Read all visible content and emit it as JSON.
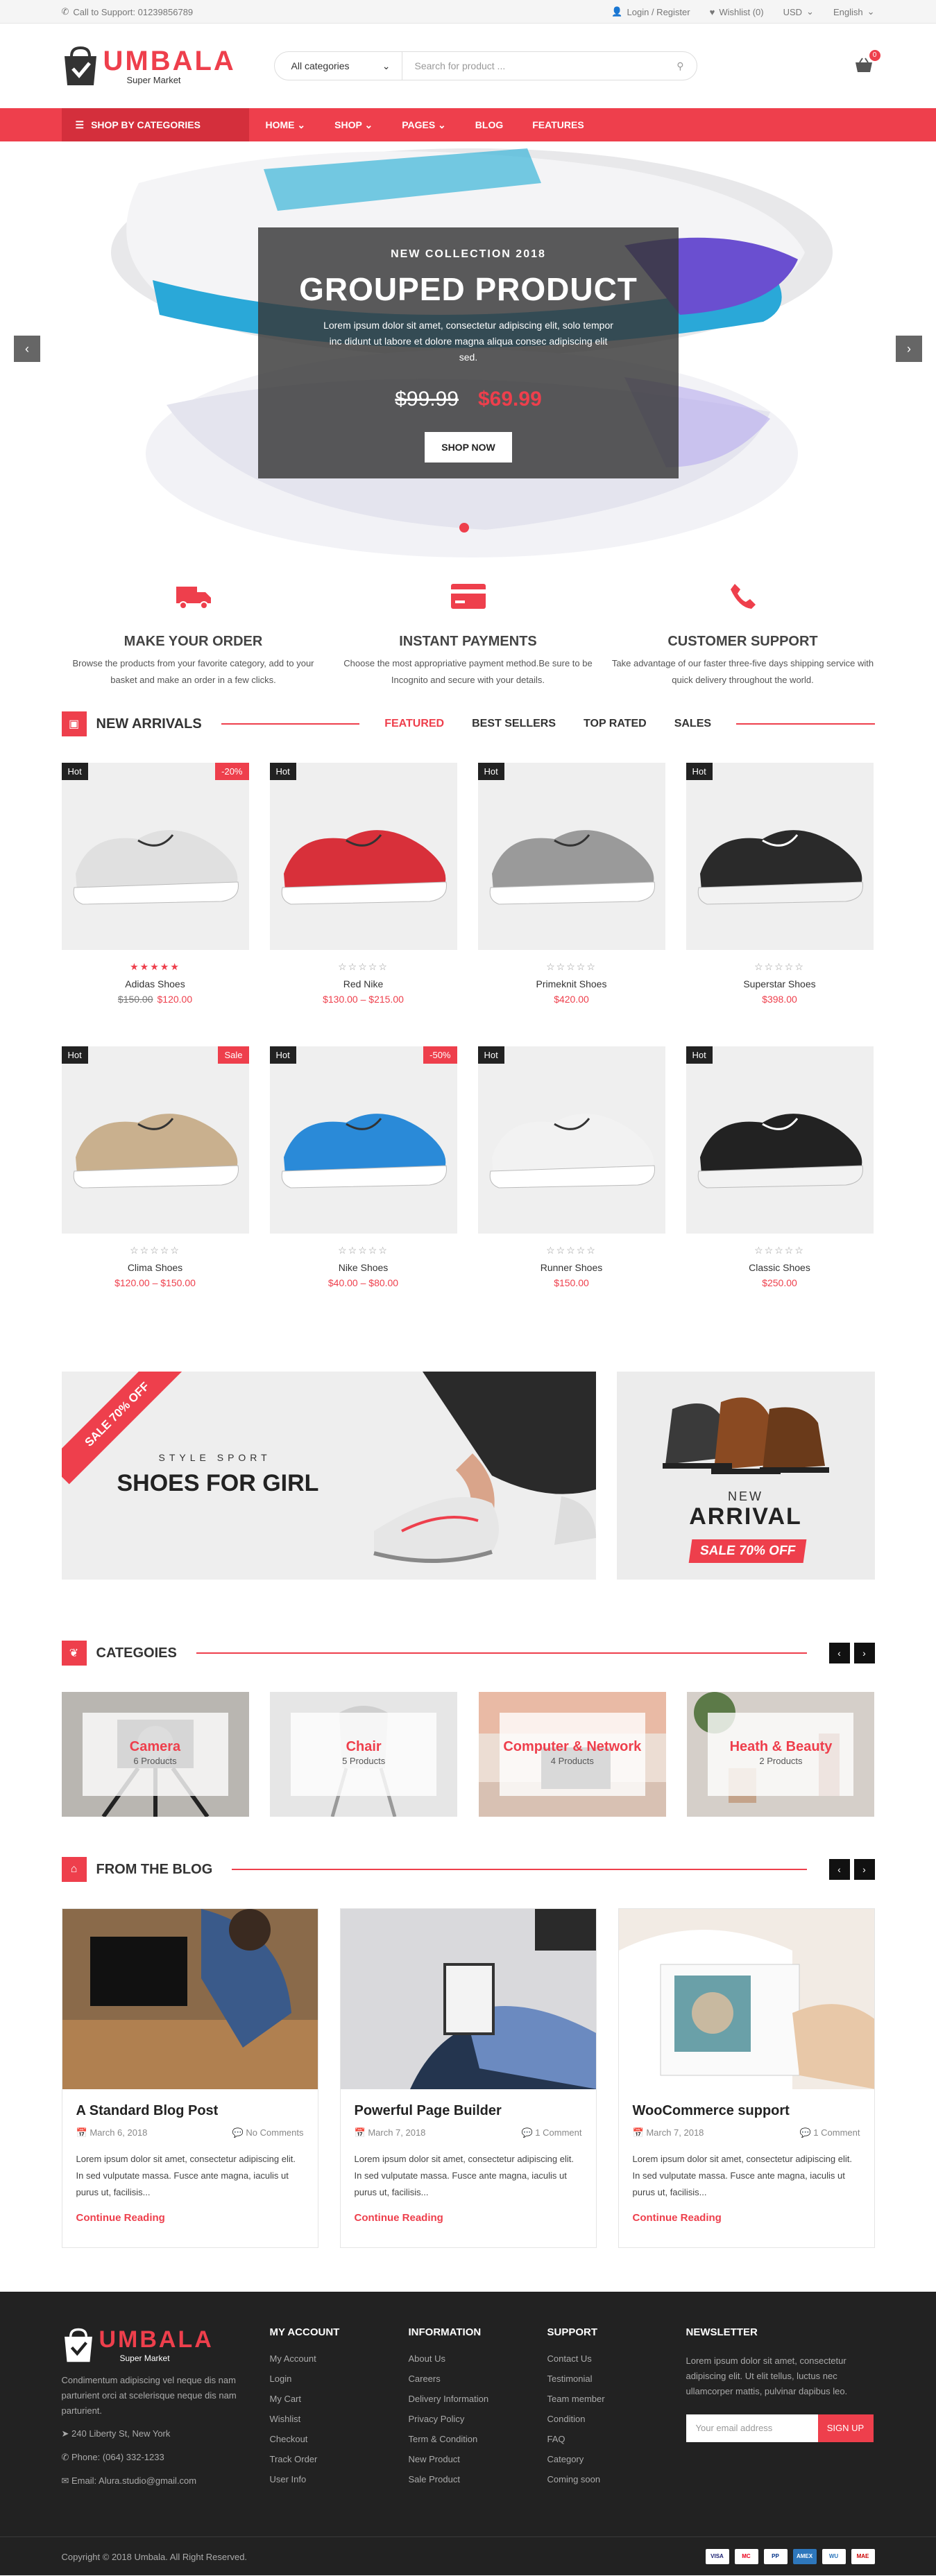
{
  "topbar": {
    "support": "Call to Support: 01239856789",
    "login": "Login / Register",
    "wishlist": "Wishlist (0)",
    "currency": "USD",
    "language": "English"
  },
  "logo": {
    "name": "UMBALA",
    "sub": "Super Market"
  },
  "search": {
    "category": "All categories",
    "placeholder": "Search for product ..."
  },
  "cart": {
    "count": "0"
  },
  "nav": {
    "categories": "SHOP BY CATEGORIES",
    "items": [
      "HOME",
      "SHOP",
      "PAGES",
      "BLOG",
      "FEATURES"
    ]
  },
  "hero": {
    "kicker": "NEW COLLECTION 2018",
    "title": "GROUPED PRODUCT",
    "text": "Lorem ipsum dolor sit amet, consectetur adipiscing elit, solo tempor inc didunt ut labore et dolore magna aliqua consec adipiscing elit sed.",
    "old_price": "$99.99",
    "new_price": "$69.99",
    "button": "SHOP NOW"
  },
  "features": [
    {
      "icon": "truck-icon",
      "title": "MAKE YOUR ORDER",
      "text": "Browse the products from your favorite category, add to your basket and make an order in a few clicks."
    },
    {
      "icon": "credit-card-icon",
      "title": "INSTANT PAYMENTS",
      "text": "Choose the most appropriative payment method.Be sure to be Incognito and secure with your details."
    },
    {
      "icon": "phone-icon",
      "title": "CUSTOMER SUPPORT",
      "text": "Take advantage of our faster three-five days shipping service with quick delivery throughout the world."
    }
  ],
  "arrivals": {
    "title": "NEW ARRIVALS",
    "tabs": [
      "FEATURED",
      "BEST SELLERS",
      "TOP RATED",
      "SALES"
    ],
    "products": [
      {
        "name": "Adidas Shoes",
        "old": "$150.00",
        "price": "$120.00",
        "hot": "Hot",
        "badge": "-20%",
        "rated": true,
        "color": "#e0e0e0"
      },
      {
        "name": "Red Nike",
        "old": "",
        "price": "$130.00 – $215.00",
        "hot": "Hot",
        "badge": "",
        "rated": false,
        "color": "#d8303a"
      },
      {
        "name": "Primeknit Shoes",
        "old": "",
        "price": "$420.00",
        "hot": "Hot",
        "badge": "",
        "rated": false,
        "color": "#9a9a9a"
      },
      {
        "name": "Superstar Shoes",
        "old": "",
        "price": "$398.00",
        "hot": "Hot",
        "badge": "",
        "rated": false,
        "color": "#2a2a2a"
      },
      {
        "name": "Clima Shoes",
        "old": "",
        "price": "$120.00 – $150.00",
        "hot": "Hot",
        "badge": "Sale",
        "rated": false,
        "color": "#c9b08e"
      },
      {
        "name": "Nike Shoes",
        "old": "",
        "price": "$40.00 – $80.00",
        "hot": "Hot",
        "badge": "-50%",
        "rated": false,
        "color": "#2a8ad8"
      },
      {
        "name": "Runner Shoes",
        "old": "",
        "price": "$150.00",
        "hot": "Hot",
        "badge": "",
        "rated": false,
        "color": "#f2f2f2"
      },
      {
        "name": "Classic Shoes",
        "old": "",
        "price": "$250.00",
        "hot": "Hot",
        "badge": "",
        "rated": false,
        "color": "#222222"
      }
    ]
  },
  "banners": {
    "ribbon": "SALE 70% OFF",
    "style": "STYLE SPORT",
    "girl": "SHOES FOR GIRL",
    "new": "NEW",
    "arrival": "ARRIVAL",
    "sale": "SALE 70% OFF"
  },
  "categories": {
    "title": "CATEGOIES",
    "items": [
      {
        "name": "Camera",
        "count": "6 Products"
      },
      {
        "name": "Chair",
        "count": "5 Products"
      },
      {
        "name": "Computer & Network",
        "count": "4 Products"
      },
      {
        "name": "Heath & Beauty",
        "count": "2 Products"
      }
    ]
  },
  "blog": {
    "title": "FROM THE BLOG",
    "posts": [
      {
        "title": "A Standard Blog Post",
        "date": "March 6, 2018",
        "comments": "No Comments",
        "text": "Lorem ipsum dolor sit amet, consectetur adipiscing elit. In sed vulputate massa. Fusce ante magna, iaculis ut purus ut, facilisis...",
        "link": "Continue Reading"
      },
      {
        "title": "Powerful Page Builder",
        "date": "March 7, 2018",
        "comments": "1 Comment",
        "text": "Lorem ipsum dolor sit amet, consectetur adipiscing elit. In sed vulputate massa. Fusce ante magna, iaculis ut purus ut, facilisis...",
        "link": "Continue Reading"
      },
      {
        "title": "WooCommerce support",
        "date": "March 7, 2018",
        "comments": "1 Comment",
        "text": "Lorem ipsum dolor sit amet, consectetur adipiscing elit. In sed vulputate massa. Fusce ante magna, iaculis ut purus ut, facilisis...",
        "link": "Continue Reading"
      }
    ]
  },
  "footer": {
    "about": "Condimentum adipiscing vel neque dis nam parturient orci at scelerisque neque dis nam parturient.",
    "address": "240 Liberty St, New York",
    "phone": "Phone: (064) 332-1233",
    "email": "Email: Alura.studio@gmail.com",
    "account": {
      "title": "MY ACCOUNT",
      "items": [
        "My Account",
        "Login",
        "My Cart",
        "Wishlist",
        "Checkout",
        "Track Order",
        "User Info"
      ]
    },
    "information": {
      "title": "INFORMATION",
      "items": [
        "About Us",
        "Careers",
        "Delivery Information",
        "Privacy Policy",
        "Term & Condition",
        "New Product",
        "Sale Product"
      ]
    },
    "support": {
      "title": "SUPPORT",
      "items": [
        "Contact Us",
        "Testimonial",
        "Team member",
        "Condition",
        "FAQ",
        "Category",
        "Coming soon"
      ]
    },
    "newsletter": {
      "title": "NEWSLETTER",
      "text": "Lorem ipsum dolor sit amet, consectetur adipiscing elit. Ut elit tellus, luctus nec ullamcorper mattis, pulvinar dapibus leo.",
      "placeholder": "Your email address",
      "button": "SIGN UP"
    },
    "copyright": "Copyright © 2018 Umbala. All Right Reserved.",
    "payments": [
      "VISA",
      "MC",
      "PP",
      "AMEX",
      "WU",
      "MAE"
    ]
  }
}
